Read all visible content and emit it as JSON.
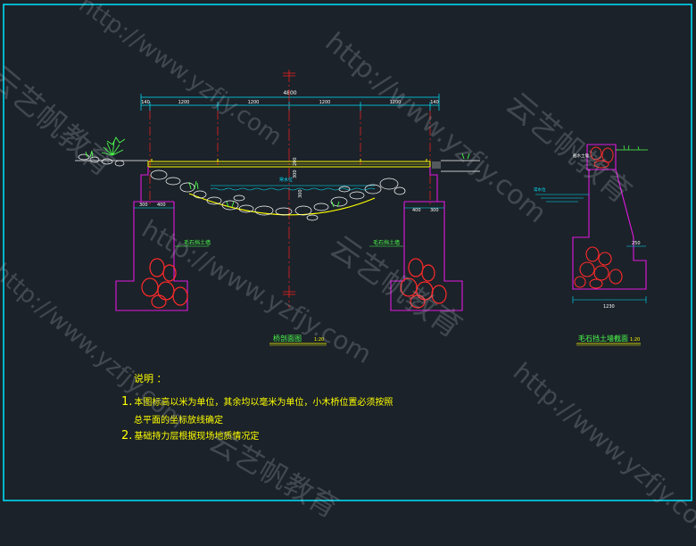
{
  "drawing": {
    "bridge_elevation": {
      "title": "桥剖面图",
      "scale": "1:20",
      "dim_total": "4800",
      "dim_segments": [
        "140",
        "1200",
        "1200",
        "1200",
        "1200",
        "140"
      ],
      "dim_abutment_left": [
        "300",
        "400"
      ],
      "dim_abutment_right": [
        "400",
        "300"
      ],
      "dim_deck": [
        "200",
        "300"
      ],
      "dim_water": "300",
      "water_label": "常水位",
      "wall_label_left": "毛石挡土墙",
      "wall_label_right": "毛石挡土墙"
    },
    "wall_section": {
      "title": "毛石挡土墙截面",
      "scale": "1:20",
      "top_label": "截水土墙",
      "water_label": "常水位",
      "dim_step": "250",
      "dim_base": "1230"
    },
    "notes": {
      "heading": "说明 ：",
      "items": [
        {
          "num": "1.",
          "text": "本图标高以米为单位，其余均以毫米为单位，小木桥位置必须按照"
        },
        {
          "num": "",
          "text": "总平面的坐标放线确定"
        },
        {
          "num": "2.",
          "text": "基础持力层根据现场地质情况定"
        }
      ]
    }
  },
  "watermark": {
    "url": "http://www.yzfjy.com",
    "brand": "云艺帆教育"
  },
  "colors": {
    "background": "#1b2229",
    "frame": "#00e5ff",
    "dimension": "#00e5ff",
    "deck": "#ffff00",
    "abutment": "#e018e0",
    "centerline": "#ff2020",
    "rocks": "#ffffff",
    "boulders": "#ff2a2a",
    "vegetation": "#4cff4c",
    "water": "#00e5ff",
    "notes": "#ffff00"
  }
}
